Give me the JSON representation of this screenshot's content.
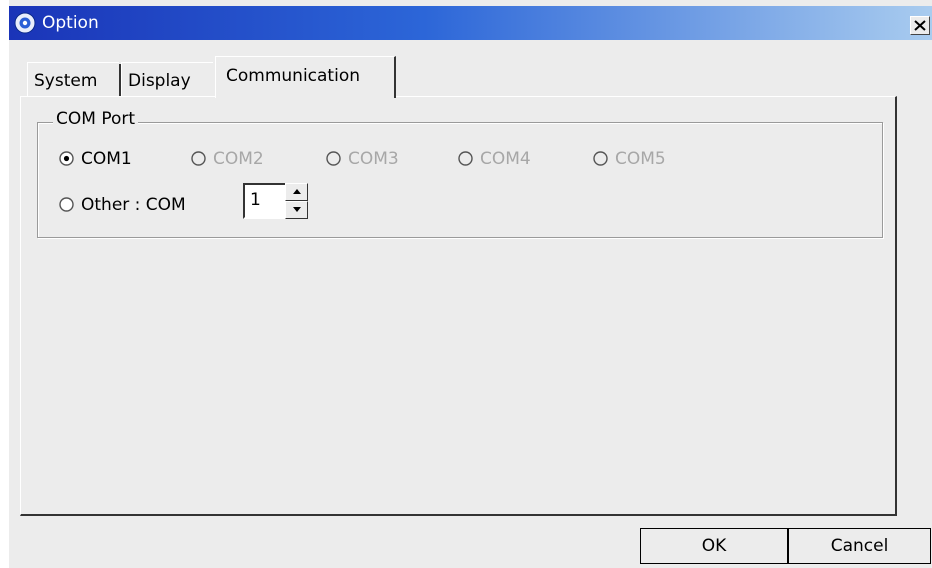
{
  "window": {
    "title": "Option",
    "icon": "app-gear-icon",
    "close_label": "close"
  },
  "tabs": [
    {
      "label": "System",
      "selected": false
    },
    {
      "label": "Display",
      "selected": false
    },
    {
      "label": "Communication",
      "selected": true
    }
  ],
  "com_port": {
    "group_label": "COM Port",
    "options": [
      {
        "label": "COM1",
        "checked": true,
        "enabled": true
      },
      {
        "label": "COM2",
        "checked": false,
        "enabled": false
      },
      {
        "label": "COM3",
        "checked": false,
        "enabled": false
      },
      {
        "label": "COM4",
        "checked": false,
        "enabled": false
      },
      {
        "label": "COM5",
        "checked": false,
        "enabled": false
      }
    ],
    "other": {
      "label": "Other : COM",
      "checked": false,
      "value": "1"
    }
  },
  "buttons": {
    "ok": "OK",
    "cancel": "Cancel"
  },
  "colors": {
    "titlebar_start": "#1a34b8",
    "titlebar_end": "#a9ccef",
    "face": "#ececec",
    "disabled_text": "#a7a7a7"
  }
}
